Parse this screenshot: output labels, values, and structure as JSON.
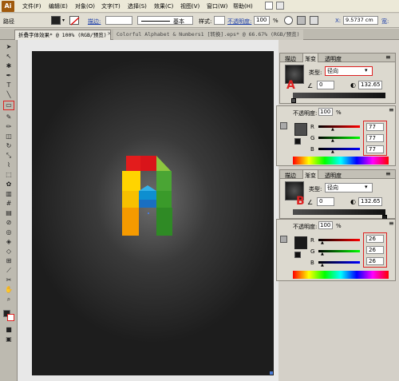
{
  "app": {
    "logo": "Ai"
  },
  "menu": [
    "文件(F)",
    "编辑(E)",
    "对象(O)",
    "文字(T)",
    "选择(S)",
    "效果(C)",
    "视图(V)",
    "窗口(W)",
    "帮助(H)"
  ],
  "control_bar": {
    "label": "路径",
    "stroke_label": "描边:",
    "stroke_style": "基本",
    "style_label": "样式:",
    "opacity_label": "不透明度:",
    "opacity_value": "100",
    "opacity_unit": "%",
    "x_label": "X:",
    "x_value": "9.5737 cm",
    "w_label": "宽:"
  },
  "tabs": [
    {
      "label": "折叠字体效果* @ 100% (RGB/预览)"
    },
    {
      "label": "Colorful Alphabet & Numbers1 [转换].eps* @ 66.67% (RGB/预览)"
    }
  ],
  "gradient_panel_a": {
    "tabs": [
      "描边",
      "渐变",
      "透明度"
    ],
    "type_label": "类型:",
    "type_value": "径向",
    "angle_value": "0",
    "ratio_value": "132.65",
    "marker": "A",
    "accent": "#d22222"
  },
  "color_panel_a": {
    "opacity_label": "不透明度:",
    "opacity_value": "100",
    "opacity_unit": "%",
    "r_label": "R",
    "g_label": "G",
    "b_label": "B",
    "r": "77",
    "g": "77",
    "b": "77",
    "swatch": "#4d4d4d"
  },
  "gradient_panel_b": {
    "tabs": [
      "描边",
      "渐变",
      "透明度"
    ],
    "type_label": "类型:",
    "type_value": "径向",
    "angle_value": "0",
    "ratio_value": "132.65",
    "marker": "B"
  },
  "color_panel_b": {
    "opacity_label": "不透明度:",
    "opacity_value": "100",
    "opacity_unit": "%",
    "r_label": "R",
    "g_label": "G",
    "b_label": "B",
    "r": "26",
    "g": "26",
    "b": "26",
    "swatch": "#1a1a1a"
  },
  "letter_colors": {
    "red": "#e31c1c",
    "yellow": "#ffd400",
    "green": "#3a9a2a",
    "blue": "#1a6fc2",
    "orange": "#f59a00",
    "lime": "#8dc63f"
  }
}
